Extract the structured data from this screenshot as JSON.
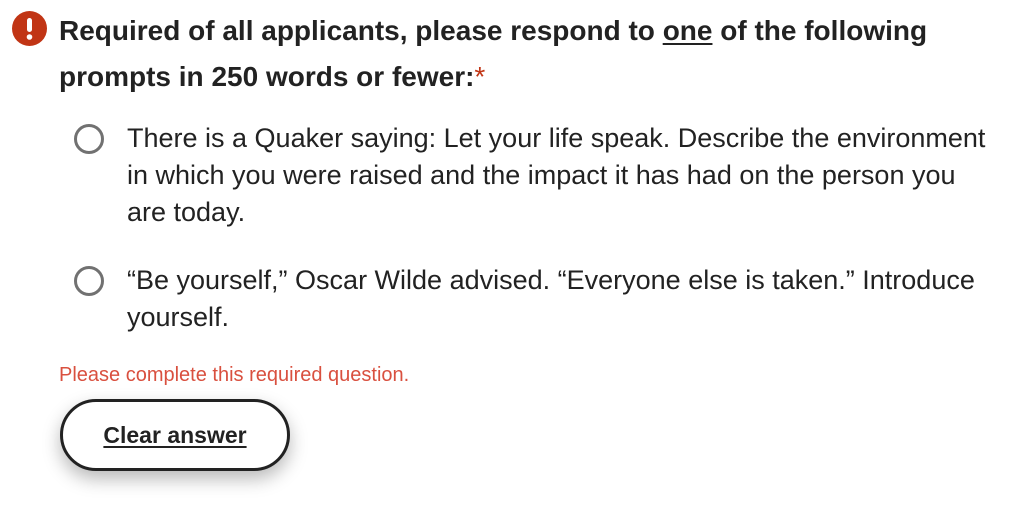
{
  "question": {
    "prompt_part1": "Required of all applicants, please respond to ",
    "prompt_underlined": "one",
    "prompt_part2": " of the following prompts in 250 words or fewer:",
    "required_marker": "*",
    "error_icon": "exclamation-circle-icon",
    "error_color": "#c13515"
  },
  "options": [
    {
      "label": "There is a Quaker saying: Let your life speak. Describe the environment in which you were raised and the impact it has had on the person you are today.",
      "selected": false
    },
    {
      "label": "“Be yourself,” Oscar Wilde advised. “Everyone else is taken.” Introduce yourself.",
      "selected": false
    }
  ],
  "validation": {
    "message": "Please complete this required question.",
    "color": "#d9503f"
  },
  "actions": {
    "clear_label": "Clear answer"
  }
}
